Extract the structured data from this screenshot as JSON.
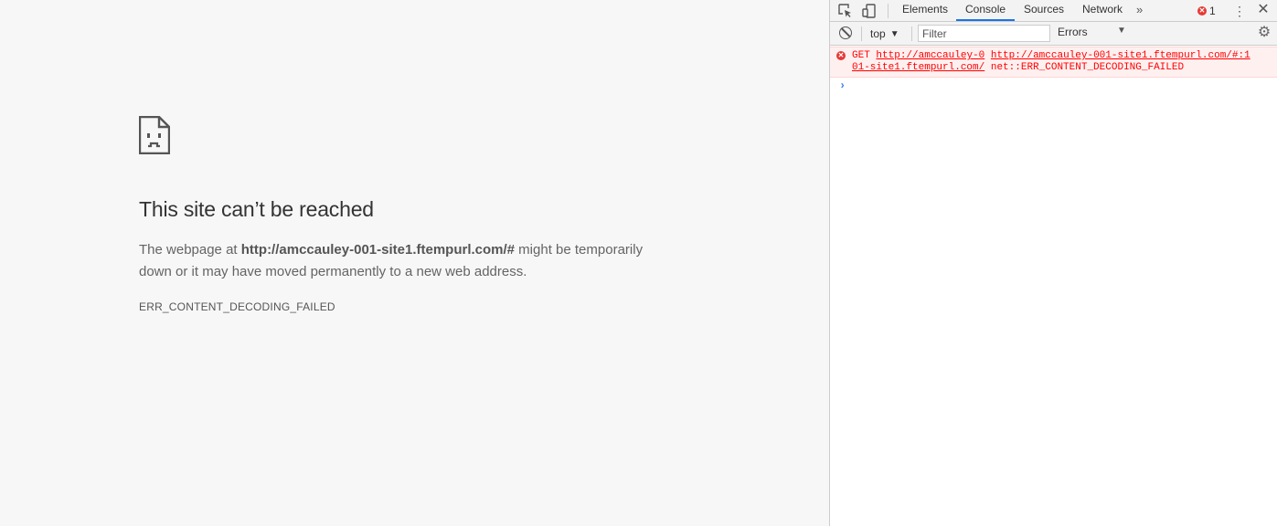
{
  "error_page": {
    "title": "This site can’t be reached",
    "message_before": "The webpage at ",
    "url": "http://amccauley-001-site1.ftempurl.com/#",
    "message_after": " might be temporarily down or it may have moved permanently to a new web address.",
    "error_code": "ERR_CONTENT_DECODING_FAILED",
    "icon": "sad-page-icon"
  },
  "devtools": {
    "tabs": [
      {
        "label": "Elements",
        "active": false
      },
      {
        "label": "Console",
        "active": true
      },
      {
        "label": "Sources",
        "active": false
      },
      {
        "label": "Network",
        "active": false
      }
    ],
    "more_tabs": "»",
    "error_count": "1",
    "accent_color": "#1a73e8",
    "error_color": "#ff0000",
    "toolbar": {
      "context": "top",
      "filter_placeholder": "Filter",
      "level": "Errors"
    },
    "console": {
      "messages": [
        {
          "level": "error",
          "method": "GET",
          "source_link": "http://amccauley-0",
          "url_line1": "http://amccauley-001-site1.ftempurl.com/#:1",
          "url_line2": "01-site1.ftempurl.com/",
          "error_text": "net::ERR_CONTENT_DECODING_FAILED"
        }
      ],
      "prompt": "›"
    }
  }
}
